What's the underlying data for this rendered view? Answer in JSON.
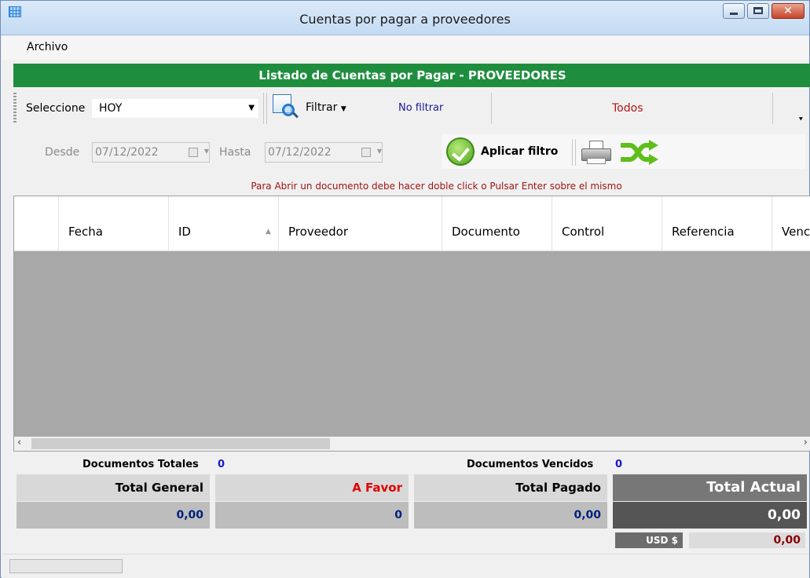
{
  "window": {
    "title": "Cuentas por pagar a proveedores",
    "icon": "grid-icon"
  },
  "menu": {
    "items": [
      "Archivo"
    ]
  },
  "banner": "Listado de Cuentas por Pagar - PROVEEDORES",
  "toolbar1": {
    "seleccione_label": "Seleccione",
    "period_value": "HOY",
    "filtrar_label": "Filtrar",
    "no_filtrar_label": "No filtrar",
    "todos_label": "Todos"
  },
  "toolbar2": {
    "desde_label": "Desde",
    "desde_value": "07/12/2022",
    "hasta_label": "Hasta",
    "hasta_value": "07/12/2022",
    "aplicar_label": "Aplicar filtro"
  },
  "hint": "Para Abrir un documento debe hacer doble click o Pulsar Enter sobre el mismo",
  "grid": {
    "columns": [
      "Fecha",
      "ID",
      "Proveedor",
      "Documento",
      "Control",
      "Referencia",
      "Venc"
    ],
    "rows": []
  },
  "summary": {
    "docs_totales_label": "Documentos Totales",
    "docs_totales_value": "0",
    "docs_vencidos_label": "Documentos Vencidos",
    "docs_vencidos_value": "0",
    "total_general_label": "Total General",
    "total_general_value": "0,00",
    "a_favor_label": "A Favor",
    "a_favor_value": "0",
    "total_pagado_label": "Total Pagado",
    "total_pagado_value": "0,00",
    "total_actual_label": "Total Actual",
    "total_actual_value": "0,00",
    "usd_label": "USD $",
    "usd_value": "0,00"
  },
  "colors": {
    "banner": "#1e8e3e",
    "a_favor": "#e00000",
    "value_blue": "#00207c"
  }
}
